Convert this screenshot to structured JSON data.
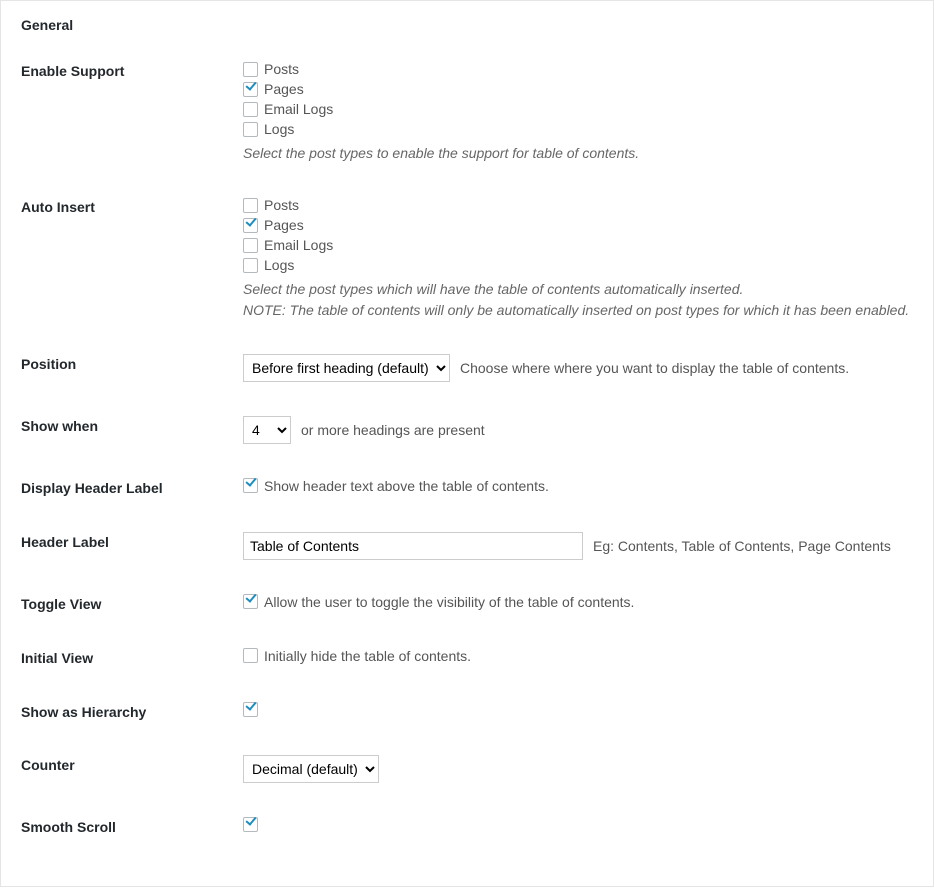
{
  "panel_title": "General",
  "enable_support": {
    "label": "Enable Support",
    "options": [
      {
        "label": "Posts",
        "checked": false
      },
      {
        "label": "Pages",
        "checked": true
      },
      {
        "label": "Email Logs",
        "checked": false
      },
      {
        "label": "Logs",
        "checked": false
      }
    ],
    "helper": "Select the post types to enable the support for table of contents."
  },
  "auto_insert": {
    "label": "Auto Insert",
    "options": [
      {
        "label": "Posts",
        "checked": false
      },
      {
        "label": "Pages",
        "checked": true
      },
      {
        "label": "Email Logs",
        "checked": false
      },
      {
        "label": "Logs",
        "checked": false
      }
    ],
    "helper1": "Select the post types which will have the table of contents automatically inserted.",
    "helper2": "NOTE: The table of contents will only be automatically inserted on post types for which it has been enabled."
  },
  "position": {
    "label": "Position",
    "selected": "Before first heading (default)",
    "hint": "Choose where where you want to display the table of contents."
  },
  "show_when": {
    "label": "Show when",
    "selected": "4",
    "hint": "or more headings are present"
  },
  "display_header_label": {
    "label": "Display Header Label",
    "checked": true,
    "hint": "Show header text above the table of contents."
  },
  "header_label": {
    "label": "Header Label",
    "value": "Table of Contents",
    "hint": "Eg: Contents, Table of Contents, Page Contents"
  },
  "toggle_view": {
    "label": "Toggle View",
    "checked": true,
    "hint": "Allow the user to toggle the visibility of the table of contents."
  },
  "initial_view": {
    "label": "Initial View",
    "checked": false,
    "hint": "Initially hide the table of contents."
  },
  "show_hierarchy": {
    "label": "Show as Hierarchy",
    "checked": true
  },
  "counter": {
    "label": "Counter",
    "selected": "Decimal (default)"
  },
  "smooth_scroll": {
    "label": "Smooth Scroll",
    "checked": true
  }
}
